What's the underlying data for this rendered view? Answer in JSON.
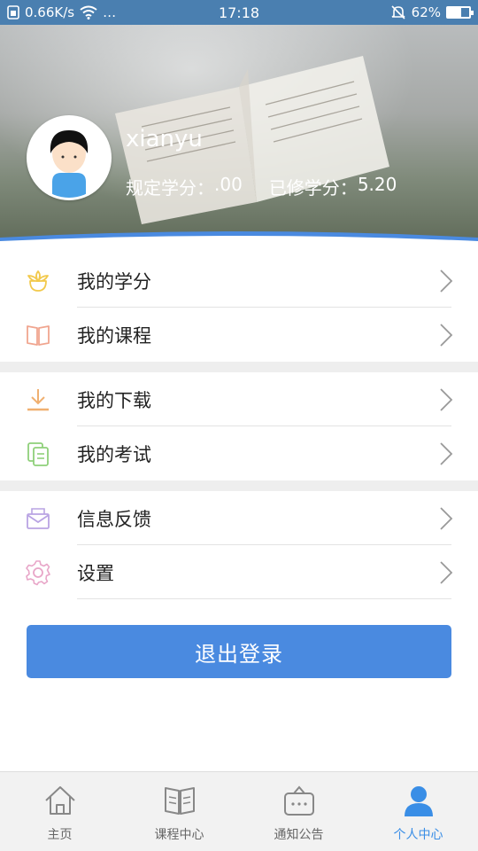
{
  "status_bar": {
    "network_speed": "0.66K/s",
    "more": "…",
    "time": "17:18",
    "battery_percent": "62%",
    "battery_level": 0.62,
    "icons": [
      "sim-icon",
      "wifi-icon",
      "silent-bell-icon",
      "battery-icon"
    ]
  },
  "profile": {
    "username": "xianyu",
    "required_credits_label": "规定学分：",
    "required_credits_value": ".00",
    "earned_credits_label": "已修学分：",
    "earned_credits_value": "5.20"
  },
  "menu": {
    "group1": [
      {
        "label": "我的学分",
        "icon": "flower-icon",
        "color": "#f2c94c"
      },
      {
        "label": "我的课程",
        "icon": "book-icon",
        "color": "#f0a58f"
      }
    ],
    "group2": [
      {
        "label": "我的下载",
        "icon": "download-icon",
        "color": "#f0b070"
      },
      {
        "label": "我的考试",
        "icon": "documents-icon",
        "color": "#8fd07a"
      }
    ],
    "group3": [
      {
        "label": "信息反馈",
        "icon": "mail-icon",
        "color": "#b9a4e3"
      },
      {
        "label": "设置",
        "icon": "gear-icon",
        "color": "#e8a6c8"
      }
    ]
  },
  "logout_label": "退出登录",
  "tabbar": {
    "tabs": [
      {
        "label": "主页",
        "icon": "home-icon",
        "active": false
      },
      {
        "label": "课程中心",
        "icon": "open-book-icon",
        "active": false
      },
      {
        "label": "通知公告",
        "icon": "notice-icon",
        "active": false
      },
      {
        "label": "个人中心",
        "icon": "person-icon",
        "active": true
      }
    ],
    "active_color": "#3a8ee6",
    "inactive_color": "#888888"
  },
  "colors": {
    "status_bar": "#4a7fb0",
    "accent": "#4a8ae0",
    "wave": "#4a8ae0"
  }
}
